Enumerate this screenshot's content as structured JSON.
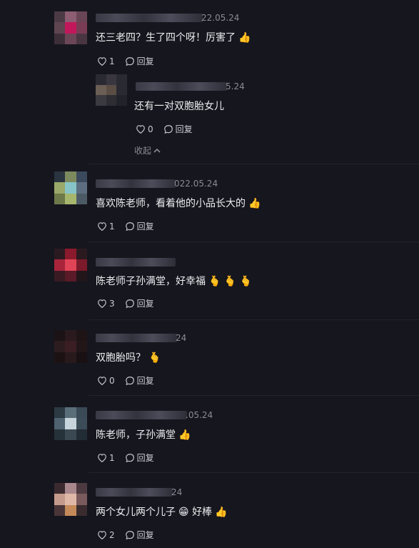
{
  "comments": [
    {
      "date": "22.05.24",
      "text": "还三老四？生了四个呀！厉害了",
      "emoji": "👍",
      "likes": "1",
      "reply_label": "回复"
    },
    {
      "date": "5.24",
      "text": "还有一对双胞胎女儿",
      "likes": "0",
      "reply_label": "回复",
      "collapse_label": "收起"
    },
    {
      "date": "022.05.24",
      "text": "喜欢陈老师，看着他的小品长大的",
      "emoji": "👍",
      "likes": "1",
      "reply_label": "回复"
    },
    {
      "date": "",
      "text": "陈老师子孙满堂，好幸福",
      "emoji": "🫰 🫰 🫰",
      "likes": "3",
      "reply_label": "回复"
    },
    {
      "date": "24",
      "text": "双胞胎吗？",
      "emoji": "🫰",
      "likes": "0",
      "reply_label": "回复"
    },
    {
      "date": ".05.24",
      "text": "陈老师，子孙满堂",
      "emoji": "👍",
      "likes": "1",
      "reply_label": "回复"
    },
    {
      "date": "24",
      "text": "两个女儿两个儿子",
      "emoji": "😁",
      "text2": "好棒",
      "emoji2": "👍",
      "likes": "2",
      "reply_label": "回复"
    }
  ],
  "colors": {
    "background": "#16161e",
    "text": "#ececf0",
    "muted": "#8b8b96"
  }
}
